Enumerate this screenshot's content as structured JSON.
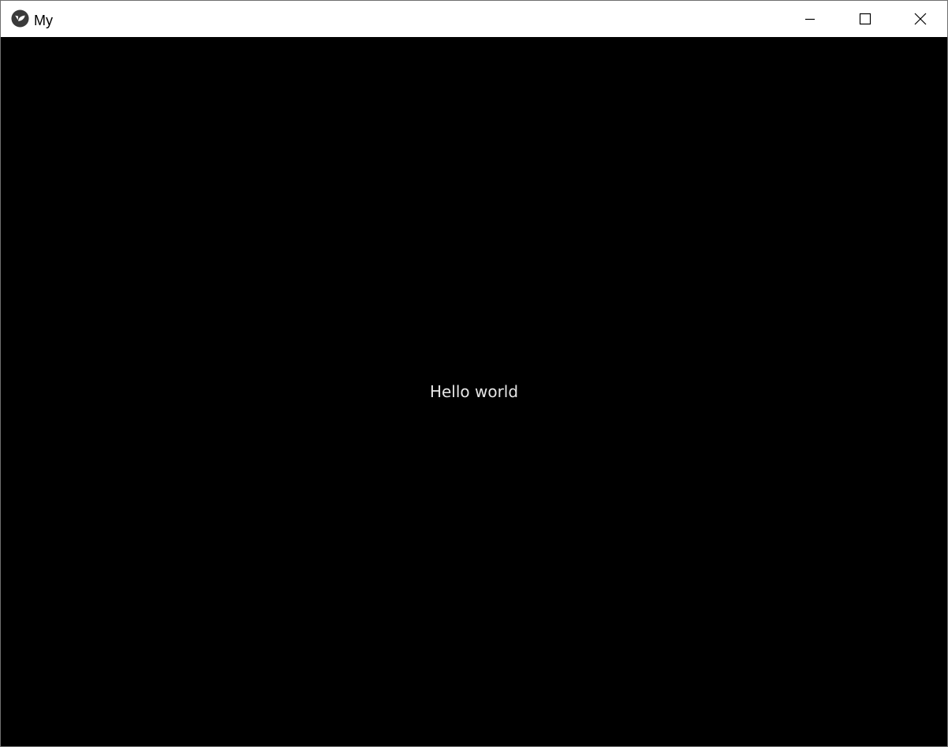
{
  "window": {
    "title": "My",
    "app_icon": "kivy-logo-icon",
    "controls": {
      "minimize_icon": "minimize-icon",
      "maximize_icon": "maximize-icon",
      "close_icon": "close-icon"
    }
  },
  "content": {
    "label": "Hello world",
    "background": "#000000",
    "text_color": "#e6e6e6"
  }
}
